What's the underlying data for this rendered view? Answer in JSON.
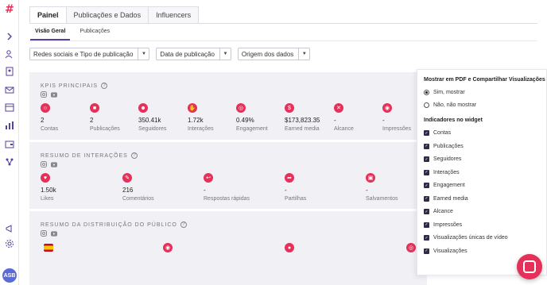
{
  "colors": {
    "accent": "#e5305a",
    "nav": "#5a3fa0",
    "check": "#2c2c4a"
  },
  "sidebar": {
    "logo": "#",
    "icons": [
      "chevron-right-icon",
      "user-search-icon",
      "contact-book-icon",
      "mail-icon",
      "calendar-icon",
      "bar-chart-icon",
      "wallet-icon",
      "network-icon",
      "megaphone-icon",
      "settings-icon"
    ],
    "avatar": "ASB"
  },
  "tabs": [
    "Painel",
    "Publicações e Dados",
    "Influencers"
  ],
  "subtabs": [
    "Visão Geral",
    "Publicações"
  ],
  "filters": [
    "Redes sociais e Tipo de publicação",
    "Data de publicação",
    "Origem dos dados"
  ],
  "kpis": {
    "title": "KPIS PRINCIPAIS",
    "help": "?",
    "items": [
      {
        "value": "2",
        "label": "Contas",
        "icon": "users-icon"
      },
      {
        "value": "2",
        "label": "Publicações",
        "icon": "post-icon"
      },
      {
        "value": "350.41k",
        "label": "Seguidores",
        "icon": "followers-icon"
      },
      {
        "value": "1.72k",
        "label": "Interações",
        "icon": "hand-icon"
      },
      {
        "value": "0.49%",
        "label": "Engagement",
        "icon": "target-icon"
      },
      {
        "value": "$173,823.35",
        "label": "Earned media",
        "icon": "dollar-icon"
      },
      {
        "value": "-",
        "label": "Alcance",
        "icon": "reach-icon"
      },
      {
        "value": "-",
        "label": "Impressões",
        "icon": "eye-icon"
      }
    ]
  },
  "interactions": {
    "title": "RESUMO DE INTERAÇÕES",
    "help": "?",
    "items": [
      {
        "value": "1.50k",
        "label": "Likes",
        "icon": "heart-icon"
      },
      {
        "value": "216",
        "label": "Comentários",
        "icon": "comment-icon"
      },
      {
        "value": "-",
        "label": "Respostas rápidas",
        "icon": "reply-icon"
      },
      {
        "value": "-",
        "label": "Partilhas",
        "icon": "share-icon"
      },
      {
        "value": "-",
        "label": "Salvamentos",
        "icon": "bookmark-icon"
      }
    ]
  },
  "audience": {
    "title": "RESUMO DA DISTRIBUIÇÃO DO PÚBLICO",
    "help": "?"
  },
  "panel": {
    "title1": "Mostrar em PDF e Compartilhar Visualizações",
    "radio_yes": "Sim, mostrar",
    "radio_no": "Não, não mostrar",
    "title2": "Indicadores no widget",
    "checks": [
      "Contas",
      "Publicações",
      "Seguidores",
      "Interações",
      "Engagement",
      "Earned media",
      "Alcance",
      "Impressões",
      "Visualizações únicas de vídeo",
      "Visualizações"
    ]
  }
}
